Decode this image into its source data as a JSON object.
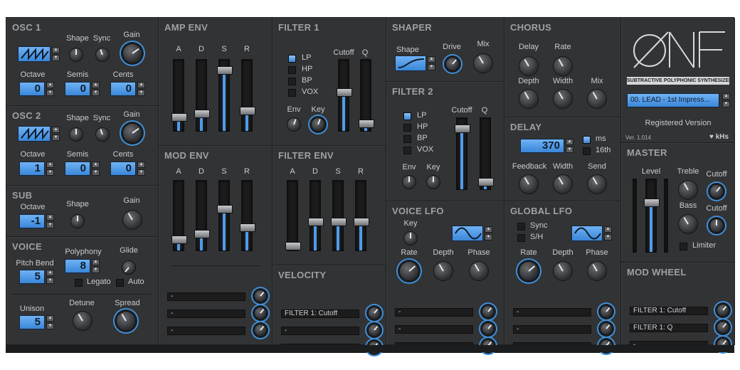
{
  "osc1": {
    "title": "OSC 1",
    "shape": "Shape",
    "sync": "Sync",
    "gain": "Gain",
    "octave": "Octave",
    "semis": "Semis",
    "cents": "Cents",
    "octave_val": "0",
    "semis_val": "0",
    "cents_val": "0"
  },
  "osc2": {
    "title": "OSC 2",
    "shape": "Shape",
    "sync": "Sync",
    "gain": "Gain",
    "octave": "Octave",
    "semis": "Semis",
    "cents": "Cents",
    "octave_val": "1",
    "semis_val": "0",
    "cents_val": "0"
  },
  "sub": {
    "title": "SUB",
    "octave": "Octave",
    "shape": "Shape",
    "gain": "Gain",
    "octave_val": "-1"
  },
  "voice": {
    "title": "VOICE",
    "pitch_bend": "Pitch Bend",
    "pitch_bend_val": "5",
    "polyphony": "Polyphony",
    "polyphony_val": "8",
    "glide": "Glide",
    "legato": "Legato",
    "auto": "Auto",
    "unison": "Unison",
    "unison_val": "5",
    "detune": "Detune",
    "spread": "Spread"
  },
  "amp_env": {
    "title": "AMP ENV",
    "a": "A",
    "d": "D",
    "s": "S",
    "r": "R",
    "levels": [
      0.15,
      0.2,
      0.9,
      0.25
    ]
  },
  "mod_env": {
    "title": "MOD ENV",
    "a": "A",
    "d": "D",
    "s": "S",
    "r": "R",
    "levels": [
      0.1,
      0.2,
      0.6,
      0.3
    ]
  },
  "filter1": {
    "title": "FILTER 1",
    "lp": "LP",
    "hp": "HP",
    "bp": "BP",
    "vox": "VOX",
    "env": "Env",
    "key": "Key",
    "cutoff": "Cutoff",
    "q": "Q",
    "cutoff_level": 0.55,
    "q_level": 0.05
  },
  "filter_env": {
    "title": "FILTER ENV",
    "a": "A",
    "d": "D",
    "s": "S",
    "r": "R",
    "levels": [
      0.0,
      0.4,
      0.4,
      0.4
    ]
  },
  "velocity": {
    "title": "VELOCITY",
    "slots": [
      "FILTER 1: Cutoff",
      "",
      ""
    ]
  },
  "shaper": {
    "title": "SHAPER",
    "shape": "Shape",
    "drive": "Drive",
    "mix": "Mix"
  },
  "filter2": {
    "title": "FILTER 2",
    "lp": "LP",
    "hp": "HP",
    "bp": "BP",
    "vox": "VOX",
    "env": "Env",
    "key": "Key",
    "cutoff": "Cutoff",
    "q": "Q",
    "cutoff_level": 0.9,
    "q_level": 0.05
  },
  "voice_lfo": {
    "title": "VOICE LFO",
    "key": "Key",
    "rate": "Rate",
    "depth": "Depth",
    "phase": "Phase"
  },
  "chorus": {
    "title": "CHORUS",
    "delay": "Delay",
    "rate": "Rate",
    "depth": "Depth",
    "width": "Width",
    "mix": "Mix"
  },
  "delay": {
    "title": "DELAY",
    "value": "370",
    "ms": "ms",
    "sixteenth": "16th",
    "feedback": "Feedback",
    "width": "Width",
    "send": "Send"
  },
  "global_lfo": {
    "title": "GLOBAL LFO",
    "sync": "Sync",
    "sh": "S/H",
    "rate": "Rate",
    "depth": "Depth",
    "phase": "Phase"
  },
  "mod_slots": {
    "mod_env": [
      "",
      "",
      ""
    ],
    "voice_lfo": [
      "",
      "",
      ""
    ],
    "global_lfo": [
      "",
      "",
      ""
    ]
  },
  "logo": {
    "subtitle": "SUBTRACTIVE POLYPHONIC SYNTHESIZER",
    "preset": "00. LEAD - 1st Impress...",
    "registered": "Registered Version",
    "version": "Ver. 1.014",
    "brand": "kHs"
  },
  "master": {
    "title": "MASTER",
    "level": "Level",
    "treble": "Treble",
    "cutoff": "Cutoff",
    "bass": "Bass",
    "cutoff2": "Cutoff",
    "limiter": "Limiter",
    "level_val": 0.7
  },
  "mod_wheel": {
    "title": "MOD WHEEL",
    "slots": [
      "FILTER 1: Cutoff",
      "FILTER 1: Q",
      ""
    ]
  },
  "colors": {
    "accent": "#4a9be6",
    "panel": "#323335",
    "background": "#2a2b2d"
  }
}
